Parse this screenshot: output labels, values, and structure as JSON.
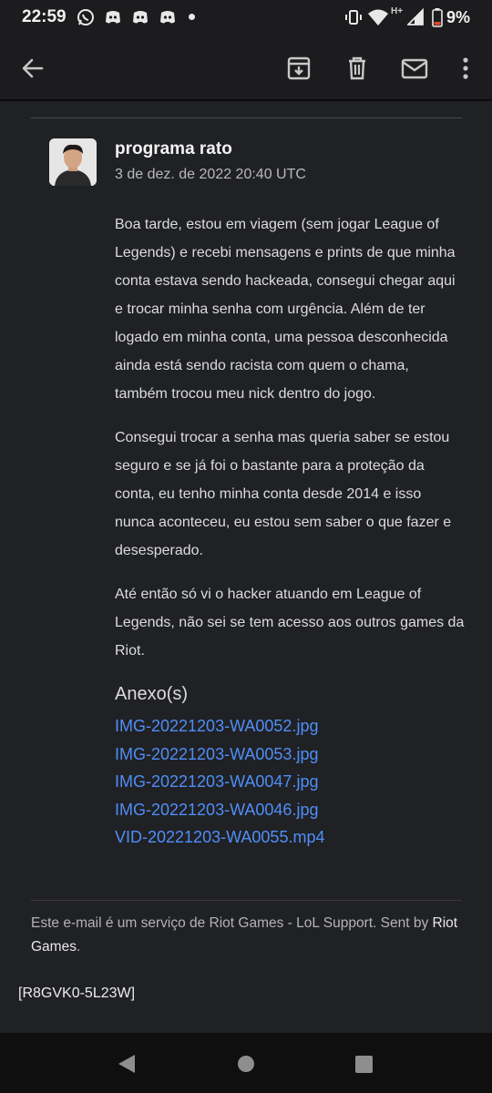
{
  "status_bar": {
    "time": "22:59",
    "network": "H+",
    "battery": "9%",
    "icons": [
      "whatsapp-icon",
      "discord-icon",
      "discord-icon",
      "discord-icon",
      "dot-icon",
      "vibrate-icon",
      "wifi-icon",
      "signal-icon",
      "battery-icon"
    ]
  },
  "toolbar": {
    "icons": [
      "back-arrow-icon",
      "archive-icon",
      "delete-icon",
      "mark-unread-icon",
      "more-options-icon"
    ]
  },
  "message": {
    "sender": "programa rato",
    "date": "3 de dez. de 2022 20:40 UTC",
    "paragraphs": [
      "Boa tarde, estou em viagem (sem jogar League of Legends) e recebi mensagens e prints de que minha conta estava sendo hackeada, consegui chegar aqui e trocar minha senha com urgência. Além de ter logado em minha conta, uma pessoa desconhecida ainda está sendo racista com quem o chama, também trocou meu nick dentro do jogo.",
      "Consegui trocar a senha mas queria saber se estou seguro e se já foi o bastante para a proteção da conta, eu tenho minha conta desde 2014 e isso nunca aconteceu, eu estou sem saber o que fazer e desesperado.",
      "Até então só vi o hacker atuando em League of Legends, não sei se tem acesso aos outros games da Riot."
    ],
    "attachments_title": "Anexo(s)",
    "attachments": [
      "IMG-20221203-WA0052.jpg",
      "IMG-20221203-WA0053.jpg",
      "IMG-20221203-WA0047.jpg",
      "IMG-20221203-WA0046.jpg",
      "VID-20221203-WA0055.mp4"
    ]
  },
  "footer": {
    "text": "Este e-mail é um serviço de Riot Games - LoL Support. Sent by ",
    "brand": "Riot Games",
    "end": ".",
    "reference": "[R8GVK0-5L23W]"
  },
  "colors": {
    "background": "#202124",
    "link": "#4f8ef7",
    "text": "#dcdcdc"
  }
}
